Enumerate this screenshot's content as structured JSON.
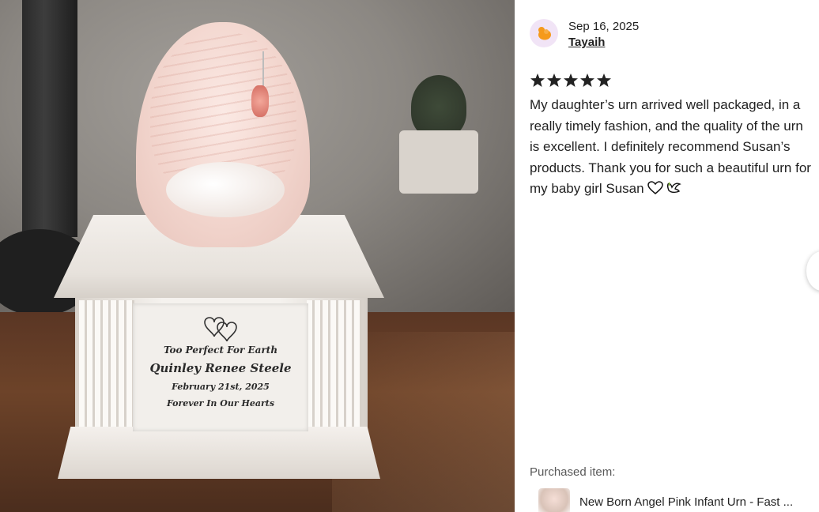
{
  "photo": {
    "alt_icon": "urn-photo",
    "plaque": {
      "line1": "Too Perfect For Earth",
      "line2": "Quinley Renee Steele",
      "line3": "February 21st, 2025",
      "line4": "Forever In Our Hearts"
    }
  },
  "review": {
    "date": "Sep 16, 2025",
    "reviewer": "Tayaih",
    "rating": 5,
    "rating_max": 5,
    "text": "My daughter’s urn arrived well packaged, in a really timely fashion, and the quality of the urn is excellent. I definitely recommend Susan’s products. Thank you for such a beautiful urn for my baby girl Susan ",
    "emoji_icons": [
      "white-heart-icon",
      "dove-icon"
    ]
  },
  "purchased": {
    "label": "Purchased item:",
    "item_title": "New Born Angel Pink Infant Urn - Fast ..."
  },
  "colors": {
    "avatar_bg": "#f1e4f6",
    "avatar_fg": "#f59a1b",
    "text": "#222222",
    "muted": "#595959"
  }
}
